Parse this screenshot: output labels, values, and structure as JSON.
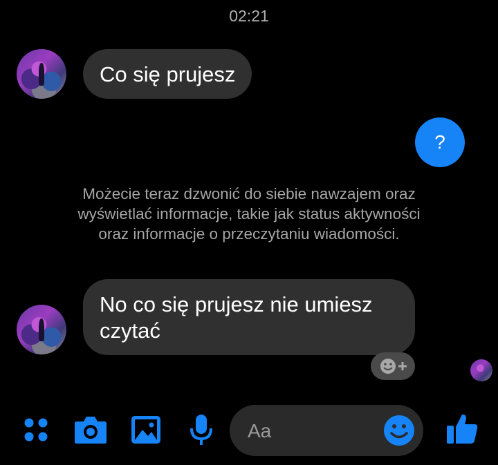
{
  "timestamp": "02:21",
  "messages": {
    "incoming_1": "Co się prujesz",
    "outgoing_1": "?",
    "system_note": "Możecie teraz dzwonić do siebie nawzajem oraz wyświetlać informacje, takie jak status aktywności oraz informacje o przeczytaniu wiadomości.",
    "incoming_2": "No co się prujesz nie umiesz czytać"
  },
  "composer": {
    "placeholder": "Aa"
  },
  "icons": {
    "menu": "four-dots-icon",
    "camera": "camera-icon",
    "gallery": "image-icon",
    "mic": "microphone-icon",
    "emoji": "smiley-icon",
    "like": "thumbs-up-icon",
    "react": "add-reaction-icon"
  },
  "colors": {
    "accent": "#1683f7",
    "bubble": "#303030",
    "background": "#000000"
  }
}
